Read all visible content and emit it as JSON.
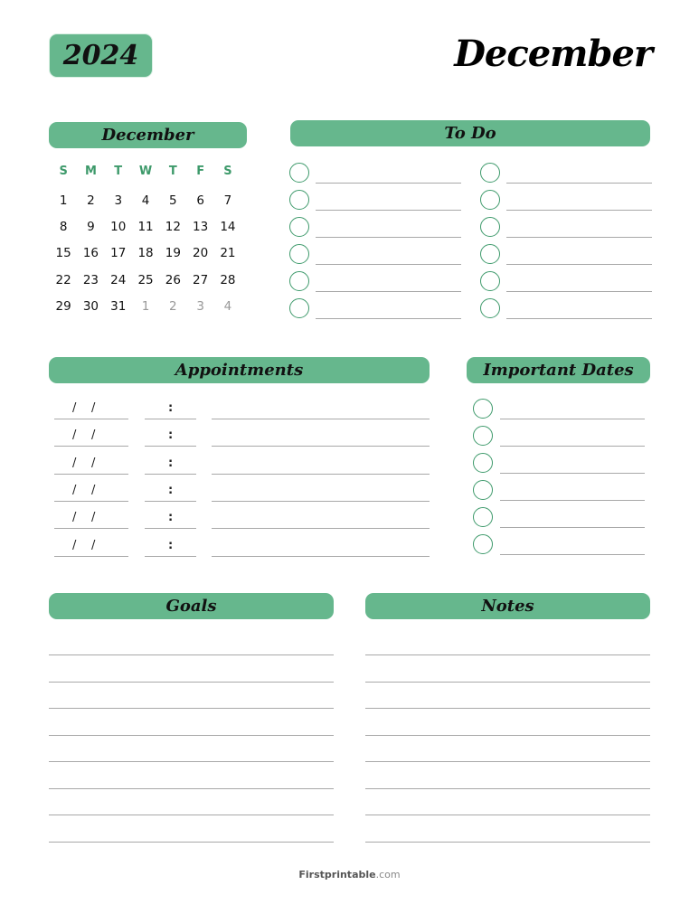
{
  "header": {
    "year": "2024",
    "month": "December"
  },
  "mini_calendar": {
    "title": "December",
    "weekdays": [
      "S",
      "M",
      "T",
      "W",
      "T",
      "F",
      "S"
    ],
    "weeks": [
      [
        {
          "d": "1"
        },
        {
          "d": "2"
        },
        {
          "d": "3"
        },
        {
          "d": "4"
        },
        {
          "d": "5"
        },
        {
          "d": "6"
        },
        {
          "d": "7"
        }
      ],
      [
        {
          "d": "8"
        },
        {
          "d": "9"
        },
        {
          "d": "10"
        },
        {
          "d": "11"
        },
        {
          "d": "12"
        },
        {
          "d": "13"
        },
        {
          "d": "14"
        }
      ],
      [
        {
          "d": "15"
        },
        {
          "d": "16"
        },
        {
          "d": "17"
        },
        {
          "d": "18"
        },
        {
          "d": "19"
        },
        {
          "d": "20"
        },
        {
          "d": "21"
        }
      ],
      [
        {
          "d": "22"
        },
        {
          "d": "23"
        },
        {
          "d": "24"
        },
        {
          "d": "25"
        },
        {
          "d": "26"
        },
        {
          "d": "27"
        },
        {
          "d": "28"
        }
      ],
      [
        {
          "d": "29"
        },
        {
          "d": "30"
        },
        {
          "d": "31"
        },
        {
          "d": "1",
          "muted": true
        },
        {
          "d": "2",
          "muted": true
        },
        {
          "d": "3",
          "muted": true
        },
        {
          "d": "4",
          "muted": true
        }
      ]
    ]
  },
  "sections": {
    "todo": "To Do",
    "appointments": "Appointments",
    "important_dates": "Important Dates",
    "goals": "Goals",
    "notes": "Notes"
  },
  "todo": {
    "rows_per_column": 6,
    "columns": 2
  },
  "appointments": {
    "rows": 6,
    "date_separator": "/",
    "time_separator": ":"
  },
  "important_dates": {
    "rows": 6
  },
  "goals": {
    "lines": 8
  },
  "notes": {
    "lines": 8
  },
  "footer": {
    "brand": "Firstprintable",
    "suffix": ".com"
  },
  "colors": {
    "accent": "#66b78d",
    "accent_dark": "#3e9a6b"
  }
}
